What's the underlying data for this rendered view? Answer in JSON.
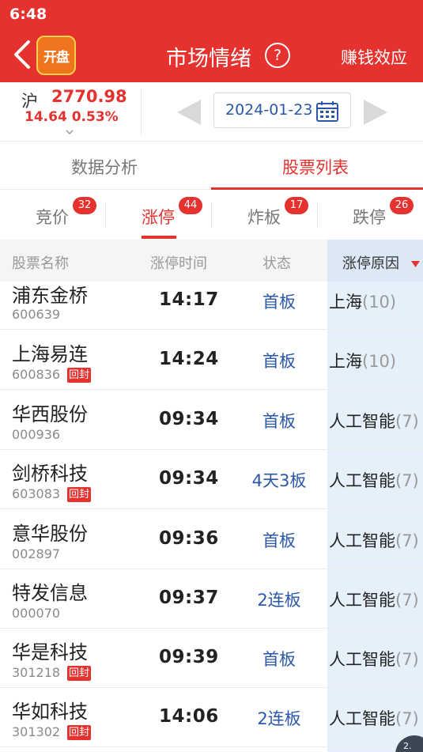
{
  "status_bar": {
    "time": "6:48"
  },
  "header": {
    "logo_text": "开盘",
    "title": "市场情绪",
    "help": "?",
    "right_action": "赚钱效应"
  },
  "index": {
    "name": "沪",
    "value": "2770.98",
    "change": "14.64",
    "change_pct": "0.53%",
    "date": "2024-01-23"
  },
  "main_tabs": [
    {
      "label": "数据分析"
    },
    {
      "label": "股票列表"
    }
  ],
  "sub_tabs": [
    {
      "label": "竞价",
      "count": "32"
    },
    {
      "label": "涨停",
      "count": "44"
    },
    {
      "label": "炸板",
      "count": "17"
    },
    {
      "label": "跌停",
      "count": "26"
    }
  ],
  "table": {
    "headers": {
      "name": "股票名称",
      "time": "涨停时间",
      "status": "状态",
      "reason": "涨停原因"
    },
    "rows": [
      {
        "name": "浦东金桥",
        "code": "600639",
        "tag": "",
        "time": "14:17",
        "status": "首板",
        "reason": "上海",
        "reason_count": "(10)"
      },
      {
        "name": "上海易连",
        "code": "600836",
        "tag": "回封",
        "time": "14:24",
        "status": "首板",
        "reason": "上海",
        "reason_count": "(10)"
      },
      {
        "name": "华西股份",
        "code": "000936",
        "tag": "",
        "time": "09:34",
        "status": "首板",
        "reason": "人工智能",
        "reason_count": "(7)"
      },
      {
        "name": "剑桥科技",
        "code": "603083",
        "tag": "回封",
        "time": "09:34",
        "status": "4天3板",
        "reason": "人工智能",
        "reason_count": "(7)"
      },
      {
        "name": "意华股份",
        "code": "002897",
        "tag": "",
        "time": "09:36",
        "status": "首板",
        "reason": "人工智能",
        "reason_count": "(7)"
      },
      {
        "name": "特发信息",
        "code": "000070",
        "tag": "",
        "time": "09:37",
        "status": "2连板",
        "reason": "人工智能",
        "reason_count": "(7)"
      },
      {
        "name": "华是科技",
        "code": "301218",
        "tag": "回封",
        "time": "09:39",
        "status": "首板",
        "reason": "人工智能",
        "reason_count": "(7)"
      },
      {
        "name": "华如科技",
        "code": "301302",
        "tag": "回封",
        "time": "14:06",
        "status": "2连板",
        "reason": "人工智能",
        "reason_count": "(7)"
      }
    ]
  },
  "float_button": {
    "label": "2."
  },
  "colors": {
    "brand_red": "#e5322f",
    "link_blue": "#2a57a8",
    "reason_bg": "#e6f0fb"
  }
}
